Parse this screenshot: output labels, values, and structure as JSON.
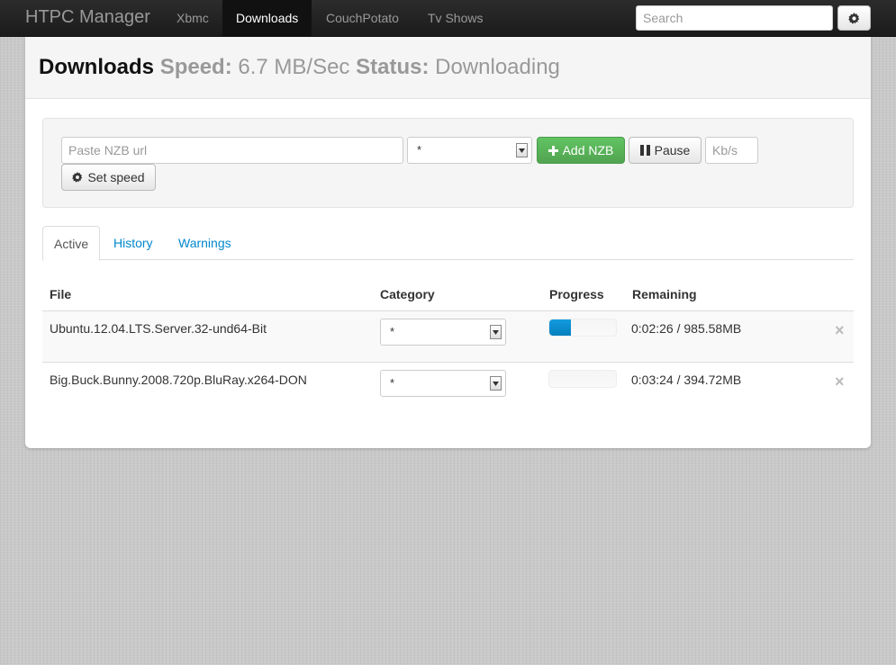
{
  "navbar": {
    "brand": "HTPC Manager",
    "items": [
      {
        "label": "Xbmc",
        "active": false
      },
      {
        "label": "Downloads",
        "active": true
      },
      {
        "label": "CouchPotato",
        "active": false
      },
      {
        "label": "Tv Shows",
        "active": false
      }
    ],
    "search_placeholder": "Search",
    "settings_icon": "gear-icon"
  },
  "header": {
    "title": "Downloads",
    "speed_label": "Speed:",
    "speed_value": "6.7 MB/Sec",
    "status_label": "Status:",
    "status_value": "Downloading"
  },
  "controls": {
    "nzb_placeholder": "Paste NZB url",
    "category_value": "*",
    "add_label": "Add NZB",
    "pause_label": "Pause",
    "speed_placeholder": "Kb/s",
    "set_speed_label": "Set speed"
  },
  "tabs": [
    {
      "label": "Active",
      "active": true
    },
    {
      "label": "History",
      "active": false
    },
    {
      "label": "Warnings",
      "active": false
    }
  ],
  "table": {
    "headers": {
      "file": "File",
      "category": "Category",
      "progress": "Progress",
      "remaining": "Remaining"
    },
    "rows": [
      {
        "file": "Ubuntu.12.04.LTS.Server.32-und64-Bit",
        "category": "*",
        "progress": 0.32,
        "remaining": "0:02:26 / 985.58MB"
      },
      {
        "file": "Big.Buck.Bunny.2008.720p.BluRay.x264-DON",
        "category": "*",
        "progress": 0.0,
        "remaining": "0:03:24 / 394.72MB"
      }
    ]
  },
  "colors": {
    "success": "#5bb75b",
    "progress": "#0e90d2",
    "link": "#0088cc"
  }
}
